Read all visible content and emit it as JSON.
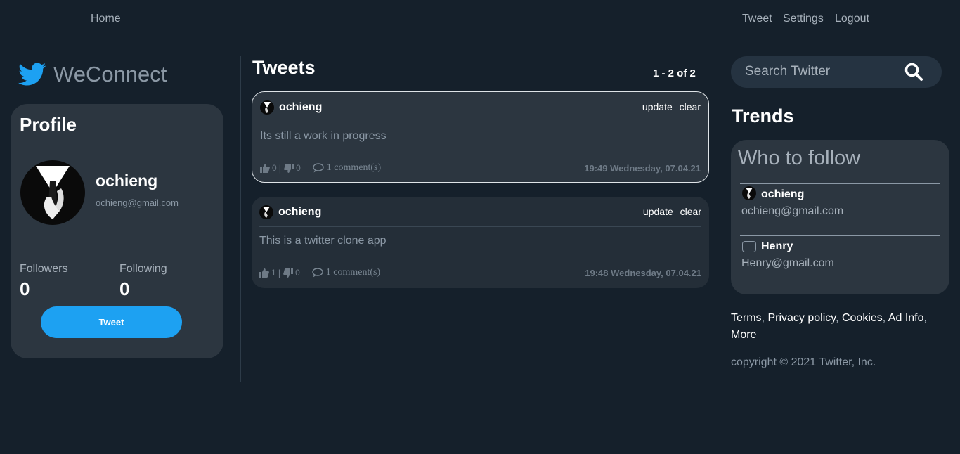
{
  "nav": {
    "home": "Home",
    "tweet": "Tweet",
    "settings": "Settings",
    "logout": "Logout"
  },
  "brand": {
    "name": "WeConnect",
    "icon": "twitter-bird-icon",
    "color": "#1da1f2"
  },
  "profile": {
    "title": "Profile",
    "name": "ochieng",
    "email": "ochieng@gmail.com",
    "followers_label": "Followers",
    "followers": "0",
    "following_label": "Following",
    "following": "0",
    "tweet_button": "Tweet"
  },
  "tweets": {
    "title": "Tweets",
    "pager": "1 - 2 of 2",
    "update_label": "update",
    "clear_label": "clear",
    "items": [
      {
        "user": "ochieng",
        "text": "Its still a work in progress",
        "likes": "0",
        "dislikes": "0",
        "comments": "1 comment(s)",
        "time": "19:49 Wednesday, 07.04.21"
      },
      {
        "user": "ochieng",
        "text": "This is a twitter clone app",
        "likes": "1",
        "dislikes": "0",
        "comments": "1 comment(s)",
        "time": "19:48 Wednesday, 07.04.21"
      }
    ]
  },
  "search": {
    "placeholder": "Search Twitter"
  },
  "trends": {
    "title": "Trends",
    "follow_title": "Who to follow",
    "users": [
      {
        "name": "ochieng",
        "email": "ochieng@gmail.com"
      },
      {
        "name": "Henry",
        "email": "Henry@gmail.com"
      }
    ]
  },
  "footer": {
    "links": [
      "Terms",
      "Privacy policy",
      "Cookies",
      "Ad Info",
      "More"
    ],
    "copyright": "copyright © 2021 Twitter, Inc."
  }
}
